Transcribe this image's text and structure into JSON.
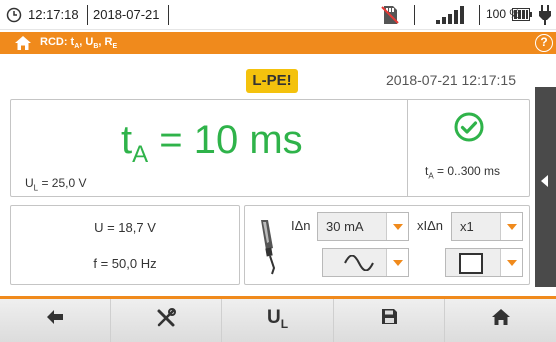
{
  "status": {
    "time": "12:17:18",
    "date": "2018-07-21",
    "battery_percent": "100 %",
    "signal_bars": 5
  },
  "header": {
    "title": "RCD: tA, UB, RE",
    "title_parts": [
      "RCD: t",
      "A",
      ", U",
      "B",
      ", R",
      "E"
    ],
    "help_label": "?"
  },
  "result": {
    "circuit_badge": "L-PE!",
    "datetime": "2018-07-21 12:17:15",
    "main_prefix": "t",
    "main_sub": "A",
    "main_value": " = 10 ms",
    "ul_prefix": "U",
    "ul_sub": "L",
    "ul_value": " = 25,0 V",
    "range_prefix": "t",
    "range_sub": "A",
    "range_value": " = 0..300 ms",
    "status": "pass"
  },
  "measurements": {
    "voltage": "U = 18,7 V",
    "frequency": "f = 50,0 Hz"
  },
  "settings": {
    "idn_label": "IΔn",
    "idn_value": "30 mA",
    "multiplier_label": "xIΔn",
    "multiplier_value": "x1",
    "waveform": "sine",
    "rcd_type": "standard"
  },
  "toolbar": {
    "ul_label": "U",
    "ul_sub": "L"
  },
  "colors": {
    "accent": "#f08a1c",
    "result_green": "#2fb34a",
    "badge_yellow": "#f4c20d"
  }
}
